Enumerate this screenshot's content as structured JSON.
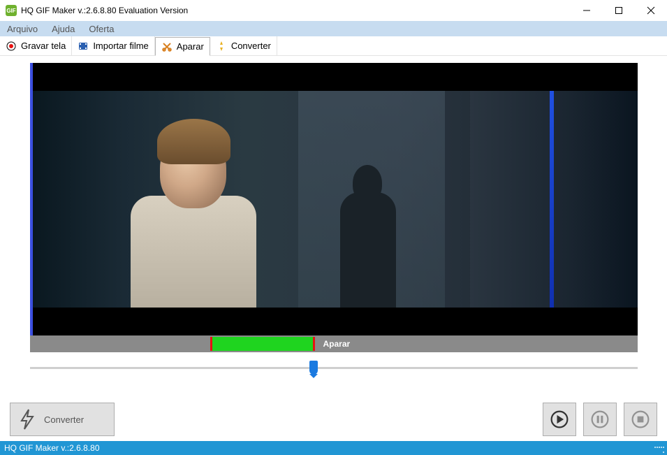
{
  "titlebar": {
    "app_icon_text": "GIF",
    "title": "HQ GIF Maker v.:2.6.8.80 Evaluation Version"
  },
  "menubar": {
    "items": [
      "Arquivo",
      "Ajuda",
      "Oferta"
    ]
  },
  "toolbar": {
    "tabs": [
      {
        "label": "Gravar tela",
        "icon": "record-icon"
      },
      {
        "label": "Importar filme",
        "icon": "film-icon"
      },
      {
        "label": "Aparar",
        "icon": "trim-icon",
        "active": true
      },
      {
        "label": "Converter",
        "icon": "convert-icon"
      }
    ]
  },
  "trimbar": {
    "label": "Aparar"
  },
  "bottom": {
    "convert_label": "Converter"
  },
  "statusbar": {
    "text": "HQ GIF Maker v.:2.6.8.80"
  }
}
